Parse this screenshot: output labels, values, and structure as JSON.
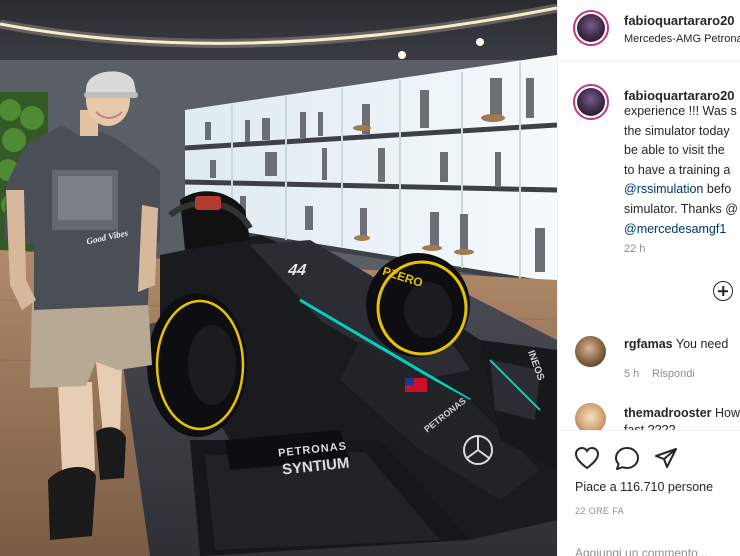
{
  "post": {
    "username": "fabioquartararo20",
    "location": "Mercedes-AMG Petronas",
    "photo_alt": "Man standing next to a Mercedes-AMG Petronas F1 car in a trophy room"
  },
  "caption": {
    "username": "fabioquartararo20",
    "lines": [
      "experience !!! Was s",
      "the simulator today",
      "be able to visit the",
      "to have a training a"
    ],
    "mention1": "@rssimulation",
    "line5_rest": " befo",
    "line6": "simulator. Thanks @",
    "mention2": "@mercedesamgf1",
    "time": "22 h"
  },
  "comments": [
    {
      "username": "rgfamas",
      "text": "You need",
      "time": "5 h",
      "reply": "Rispondi"
    },
    {
      "username": "themadrooster",
      "text": "How",
      "text2": "fast ????"
    }
  ],
  "actions": {
    "likes_text": "Piace a 116.710 persone",
    "date": "22 ORE FA",
    "add_comment": "Aggiungi un commento..."
  },
  "livery": {
    "car_number": "44",
    "sponsor1": "PETRONAS",
    "sponsor2": "SYNTIUM",
    "tyre_brand": "PZERO",
    "wing_text": "INEOS",
    "nose_text": "PETRONAS",
    "tshirt_text": "Good Vibes"
  },
  "colors": {
    "accent_teal": "#00d2be",
    "link": "#00376b",
    "muted": "#8e8e8e"
  }
}
